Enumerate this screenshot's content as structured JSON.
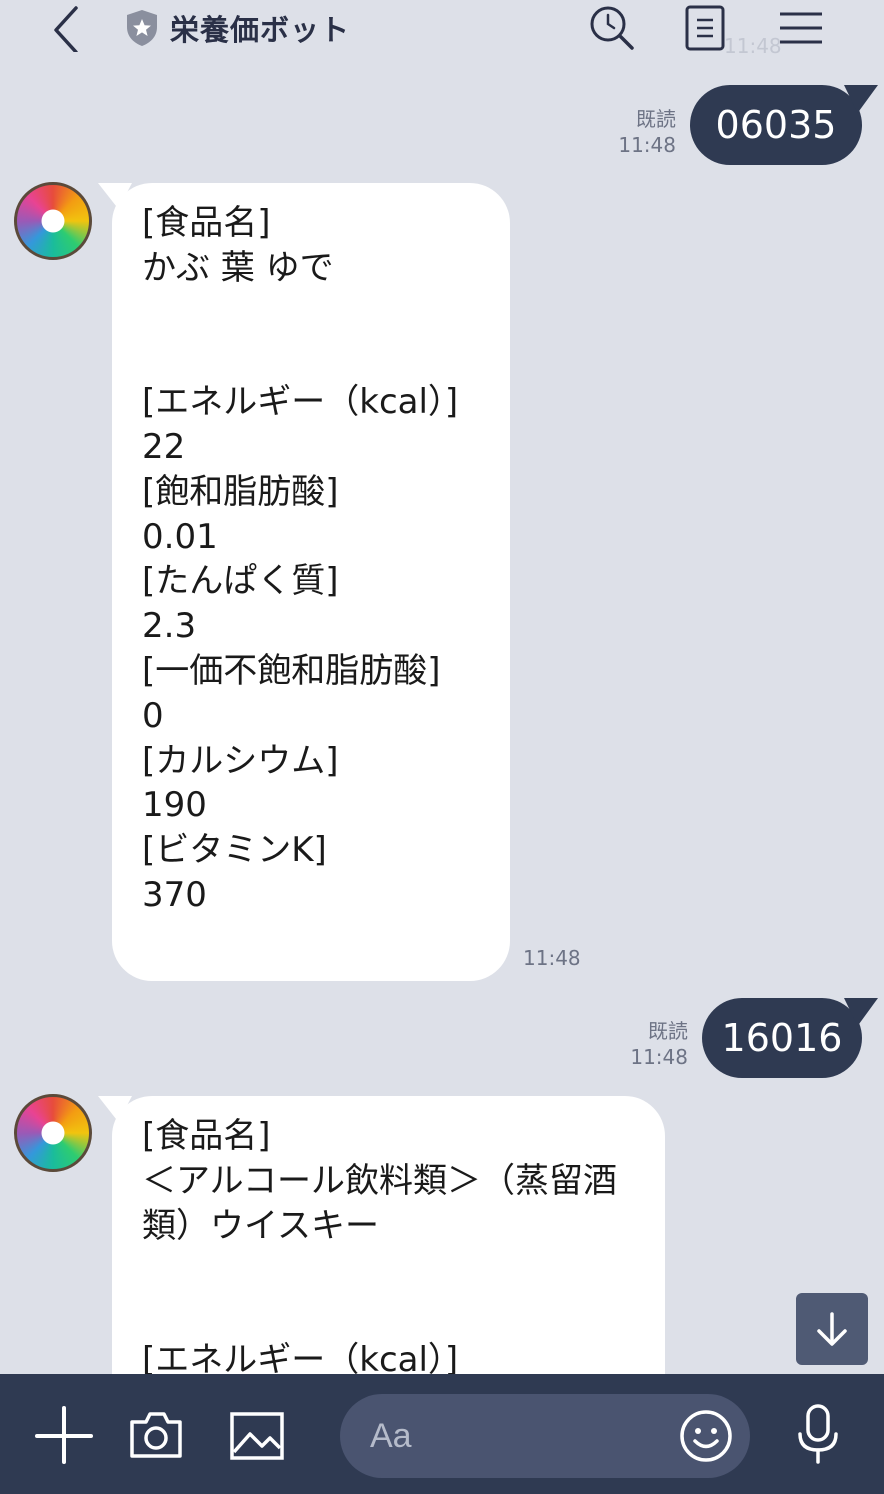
{
  "header": {
    "title": "栄養価ボット",
    "ghost_time": "11:48"
  },
  "messages": [
    {
      "dir": "out",
      "text": "06035",
      "read": "既読",
      "time": "11:48"
    },
    {
      "dir": "in",
      "text": "[食品名]\nかぶ 葉 ゆで\n\n\n[エネルギー（kcal）]\n22\n[飽和脂肪酸]\n0.01\n[たんぱく質]\n2.3\n[一価不飽和脂肪酸]\n0\n[カルシウム]\n190\n[ビタミンK]\n370",
      "time": "11:48"
    },
    {
      "dir": "out",
      "text": "16016",
      "read": "既読",
      "time": "11:48"
    },
    {
      "dir": "in",
      "text": "[食品名]\n＜アルコール飲料類＞（蒸留酒\n類）ウイスキー\n\n\n[エネルギー（kcal）]"
    }
  ],
  "composer": {
    "placeholder": "Aa"
  },
  "icons": [
    "back-icon",
    "shield-icon",
    "search-icon",
    "notes-icon",
    "menu-icon",
    "arrow-down-icon",
    "plus-icon",
    "camera-icon",
    "image-icon",
    "smile-icon",
    "mic-icon"
  ],
  "colors": {
    "background": "#dde0e8",
    "outgoing_bubble": "#2f3a52",
    "incoming_bubble": "#ffffff",
    "bottom_bar": "#2f3a52"
  }
}
